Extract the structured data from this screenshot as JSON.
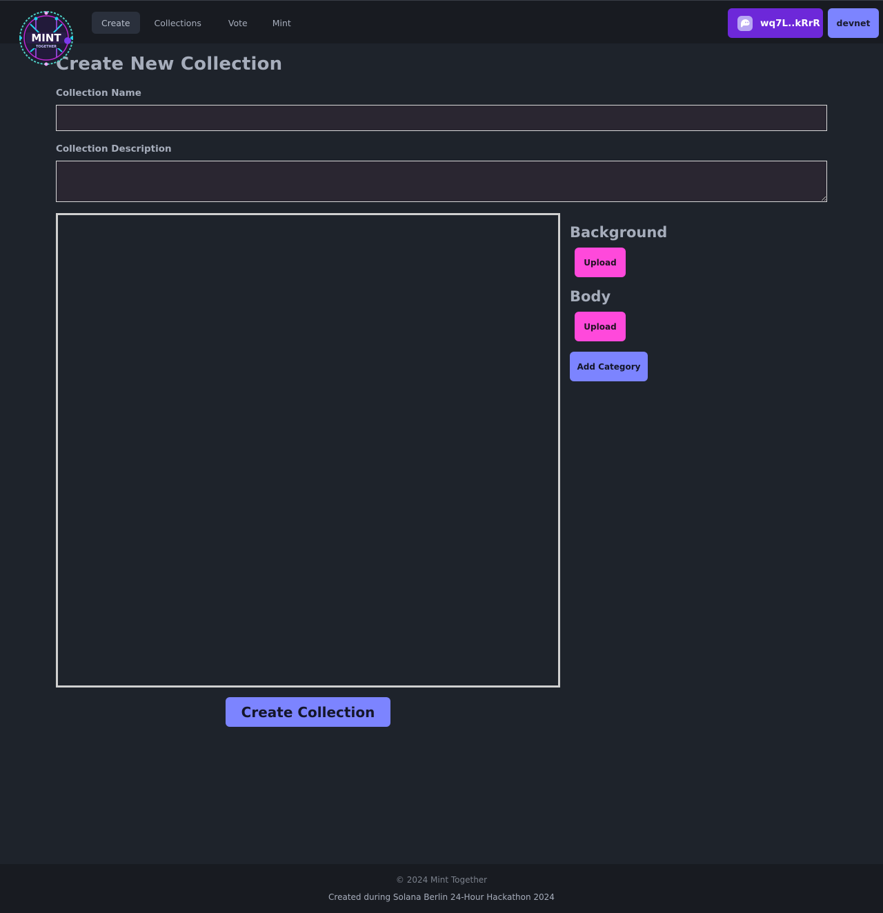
{
  "app": {
    "logo": {
      "text": "MINT",
      "subtext": "TOGETHER"
    }
  },
  "nav": {
    "items": [
      {
        "label": "Create",
        "active": true
      },
      {
        "label": "Collections",
        "active": false
      },
      {
        "label": "Vote",
        "active": false
      },
      {
        "label": "Mint",
        "active": false
      }
    ],
    "wallet": {
      "label": "wq7L..kRrR",
      "icon": "phantom-ghost-icon"
    },
    "network": {
      "label": "devnet"
    }
  },
  "main": {
    "title": "Create New Collection",
    "name_field": {
      "label": "Collection Name",
      "value": "",
      "placeholder": ""
    },
    "description_field": {
      "label": "Collection Description",
      "value": "",
      "placeholder": ""
    },
    "categories": [
      {
        "name": "Background",
        "upload_label": "Upload"
      },
      {
        "name": "Body",
        "upload_label": "Upload"
      }
    ],
    "add_category_label": "Add Category",
    "create_label": "Create Collection"
  },
  "footer": {
    "copyright": "© 2024 Mint Together",
    "credit": "Created during Solana Berlin 24-Hour Hackathon 2024"
  },
  "colors": {
    "background": "#1e232b",
    "navbar": "#181b21",
    "wallet": "#6d28d9",
    "primary": "#7c84ff",
    "upload": "#ff49db"
  }
}
